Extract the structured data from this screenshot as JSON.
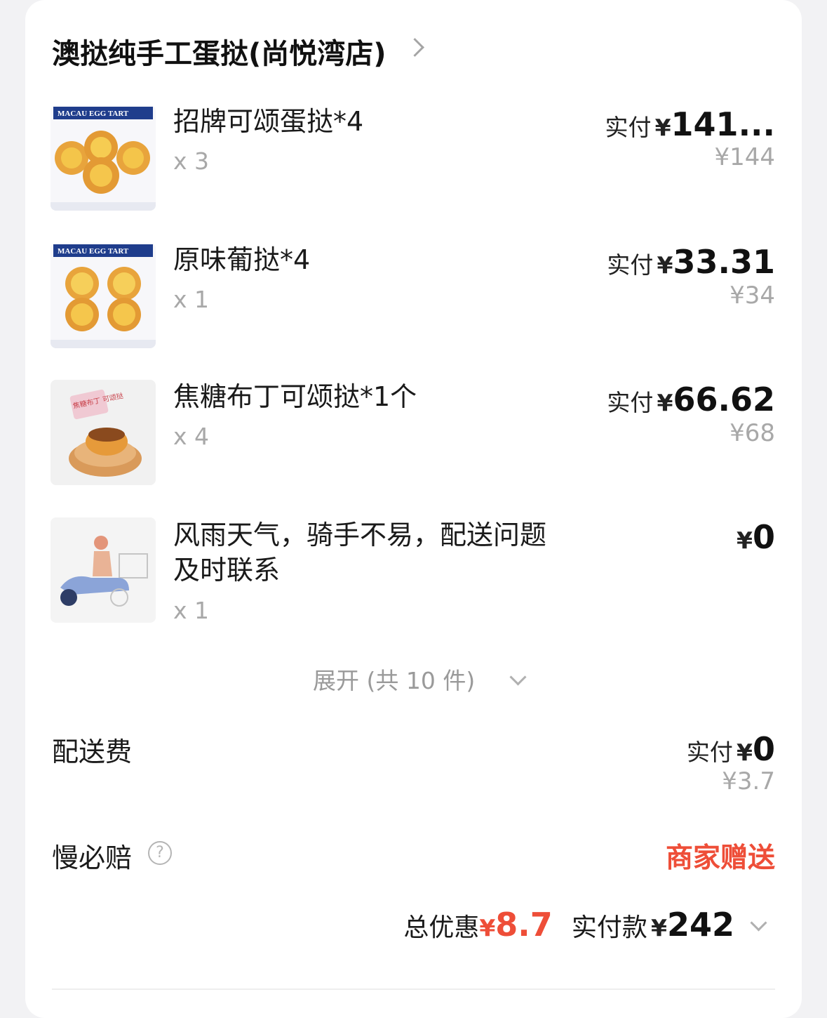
{
  "store": {
    "name": "澳挞纯手工蛋挞(尚悦湾店)"
  },
  "items": [
    {
      "name": "招牌可颂蛋挞*4",
      "qty": "x 3",
      "pay_label": "实付",
      "currency": "¥",
      "pay_amount": "141...",
      "original_price": "¥144",
      "thumb_text": "MACAU EGG TART"
    },
    {
      "name": "原味葡挞*4",
      "qty": "x 1",
      "pay_label": "实付",
      "currency": "¥",
      "pay_amount": "33.31",
      "original_price": "¥34",
      "thumb_text": "MACAU EGG TART"
    },
    {
      "name": "焦糖布丁可颂挞*1个",
      "qty": "x 4",
      "pay_label": "实付",
      "currency": "¥",
      "pay_amount": "66.62",
      "original_price": "¥68",
      "thumb_text": "焦糖布丁 可颂挞"
    },
    {
      "name_line1": "风雨天气，骑手不易，配送问题",
      "name_line2": "及时联系",
      "qty": "x 1",
      "currency": "¥",
      "pay_amount": "0"
    }
  ],
  "expand": {
    "label": "展开 (共 10 件)"
  },
  "delivery_fee": {
    "label": "配送费",
    "pay_label": "实付",
    "currency": "¥",
    "pay_amount": "0",
    "original_price": "¥3.7"
  },
  "late_guarantee": {
    "label": "慢必赔",
    "help_icon": "?",
    "value": "商家赠送"
  },
  "summary": {
    "discount_label": "总优惠",
    "currency": "¥",
    "discount_value": "8.7",
    "paid_label": "实付款",
    "paid_value": "242"
  },
  "colors": {
    "accent_red": "#ee4e38",
    "muted": "#a8a8a8",
    "background": "#f2f2f4"
  }
}
